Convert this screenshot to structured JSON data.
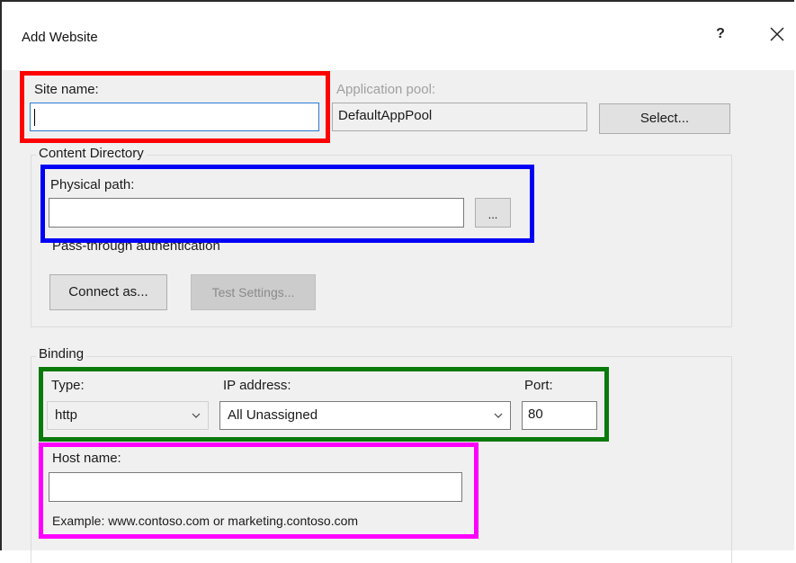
{
  "window": {
    "title": "Add Website",
    "help_label": "?",
    "close_icon": "close-icon"
  },
  "site": {
    "site_name_label": "Site name:",
    "site_name_value": "",
    "app_pool_label": "Application pool:",
    "app_pool_value": "DefaultAppPool",
    "select_button": "Select..."
  },
  "content_directory": {
    "group_title": "Content Directory",
    "physical_path_label": "Physical path:",
    "physical_path_value": "",
    "browse_button": "...",
    "pass_through_label": "Pass-through authentication",
    "connect_as_button": "Connect as...",
    "test_settings_button": "Test Settings..."
  },
  "binding": {
    "group_title": "Binding",
    "type_label": "Type:",
    "type_value": "http",
    "ip_label": "IP address:",
    "ip_value": "All Unassigned",
    "port_label": "Port:",
    "port_value": "80",
    "host_name_label": "Host name:",
    "host_name_value": "",
    "example_text": "Example: www.contoso.com or marketing.contoso.com"
  },
  "highlight_colors": {
    "site_name": "#ff0000",
    "physical_path": "#0000f5",
    "binding_row": "#0a7a0a",
    "host_name": "#ff00ff"
  }
}
